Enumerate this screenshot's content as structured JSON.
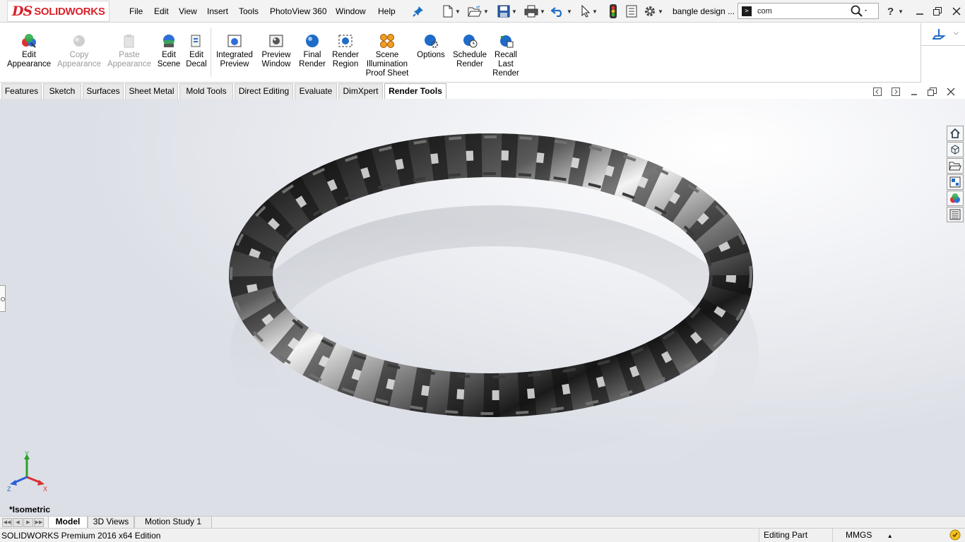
{
  "app": {
    "logo_mark": "DS",
    "logo_text": "SOLIDWORKS",
    "document_title": "bangle design ...",
    "search_value": "com"
  },
  "menu": [
    {
      "label": "File"
    },
    {
      "label": "Edit"
    },
    {
      "label": "View"
    },
    {
      "label": "Insert"
    },
    {
      "label": "Tools"
    },
    {
      "label": "PhotoView 360"
    },
    {
      "label": "Window"
    },
    {
      "label": "Help"
    }
  ],
  "toolbar_icons": [
    "pin-icon",
    "new-document-icon",
    "open-icon",
    "save-icon",
    "print-icon",
    "undo-icon",
    "select-icon",
    "rebuild-icon",
    "file-properties-icon",
    "options-gear-icon",
    "search-icon",
    "help-icon",
    "minimize-icon",
    "restore-icon",
    "close-icon"
  ],
  "ribbon": [
    {
      "line1": "Edit",
      "line2": "Appearance",
      "line3": "",
      "enabled": true,
      "icon": "edit-appearance-icon"
    },
    {
      "line1": "Copy",
      "line2": "Appearance",
      "line3": "",
      "enabled": false,
      "icon": "copy-appearance-icon"
    },
    {
      "line1": "Paste",
      "line2": "Appearance",
      "line3": "",
      "enabled": false,
      "icon": "paste-appearance-icon"
    },
    {
      "line1": "Edit",
      "line2": "Scene",
      "line3": "",
      "enabled": true,
      "icon": "edit-scene-icon"
    },
    {
      "line1": "Edit",
      "line2": "Decal",
      "line3": "",
      "enabled": true,
      "icon": "edit-decal-icon"
    },
    {
      "line1": "Integrated",
      "line2": "Preview",
      "line3": "",
      "enabled": true,
      "icon": "integrated-preview-icon"
    },
    {
      "line1": "Preview",
      "line2": "Window",
      "line3": "",
      "enabled": true,
      "icon": "preview-window-icon"
    },
    {
      "line1": "Final",
      "line2": "Render",
      "line3": "",
      "enabled": true,
      "icon": "final-render-icon"
    },
    {
      "line1": "Render",
      "line2": "Region",
      "line3": "",
      "enabled": true,
      "icon": "render-region-icon"
    },
    {
      "line1": "Scene",
      "line2": "Illumination",
      "line3": "Proof Sheet",
      "enabled": true,
      "icon": "scene-illumination-icon"
    },
    {
      "line1": "Options",
      "line2": "",
      "line3": "",
      "enabled": true,
      "icon": "options-icon"
    },
    {
      "line1": "Schedule",
      "line2": "Render",
      "line3": "",
      "enabled": true,
      "icon": "schedule-render-icon"
    },
    {
      "line1": "Recall",
      "line2": "Last",
      "line3": "Render",
      "enabled": true,
      "icon": "recall-last-render-icon"
    }
  ],
  "tabs": [
    {
      "label": "Features",
      "active": false
    },
    {
      "label": "Sketch",
      "active": false
    },
    {
      "label": "Surfaces",
      "active": false
    },
    {
      "label": "Sheet Metal",
      "active": false
    },
    {
      "label": "Mold Tools",
      "active": false
    },
    {
      "label": "Direct Editing",
      "active": false
    },
    {
      "label": "Evaluate",
      "active": false
    },
    {
      "label": "DimXpert",
      "active": false
    },
    {
      "label": "Render Tools",
      "active": true
    }
  ],
  "viewport": {
    "view_name": "*Isometric",
    "triad": {
      "x": "X",
      "y": "Y",
      "z": "Z"
    },
    "task_pane_icons": [
      "home-icon",
      "3d-parts-icon",
      "folder-icon",
      "view-palette-icon",
      "appearances-icon",
      "custom-properties-icon"
    ]
  },
  "bottom_tabs": [
    {
      "label": "Model",
      "active": true
    },
    {
      "label": "3D Views",
      "active": false
    },
    {
      "label": "Motion Study 1",
      "active": false
    }
  ],
  "status": {
    "product": "SOLIDWORKS Premium 2016 x64 Edition",
    "mode": "Editing Part",
    "units": "MMGS"
  },
  "colors": {
    "brand_red": "#d8232a",
    "ribbon_bg": "#ffffff",
    "viewport_top": "#ffffff",
    "viewport_bottom": "#dcdfe6"
  }
}
